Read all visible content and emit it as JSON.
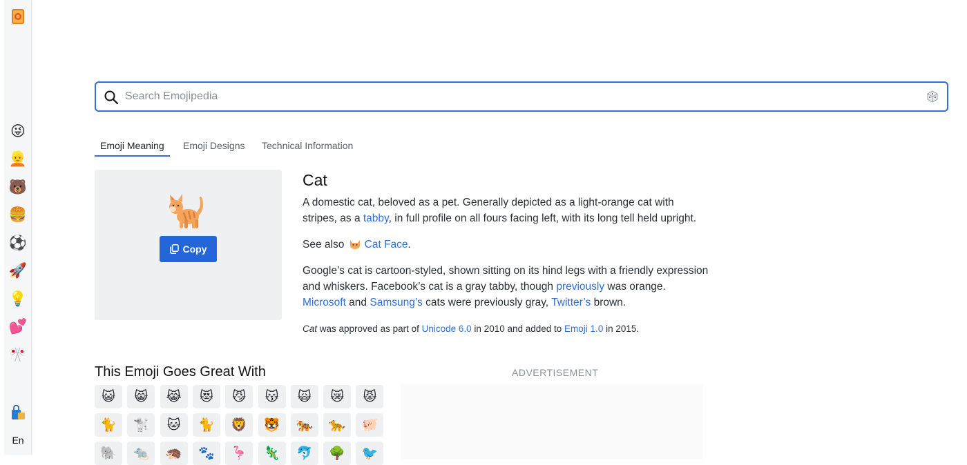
{
  "sidebar": {
    "logo_icon": "emojipedia-logo-icon",
    "items": [
      {
        "icon": "smileys-icon",
        "glyph": "😜"
      },
      {
        "icon": "people-icon",
        "glyph": "👱"
      },
      {
        "icon": "animals-icon",
        "glyph": "🐻"
      },
      {
        "icon": "food-icon",
        "glyph": "🍔"
      },
      {
        "icon": "activities-icon",
        "glyph": "⚽"
      },
      {
        "icon": "travel-icon",
        "glyph": "🚀"
      },
      {
        "icon": "objects-icon",
        "glyph": "💡"
      },
      {
        "icon": "symbols-icon",
        "glyph": "💕"
      },
      {
        "icon": "flags-icon",
        "glyph": "🎌"
      }
    ],
    "bag_icon": "shopping-bag-icon",
    "language": "En"
  },
  "search": {
    "placeholder": "Search Emojipedia",
    "value": ""
  },
  "tabs": [
    {
      "label": "Emoji Meaning",
      "active": true
    },
    {
      "label": "Emoji Designs",
      "active": false
    },
    {
      "label": "Technical Information",
      "active": false
    }
  ],
  "emoji": {
    "glyph": "🐈",
    "copy_label": "Copy",
    "title": "Cat"
  },
  "description": {
    "p1_a": "A domestic cat, beloved as a pet. Generally depicted as a light-orange cat with stripes, as a ",
    "p1_link": "tabby",
    "p1_b": ", in full profile on all fours facing left, with its long tell held upright.",
    "p2_a": "See also ",
    "p2_emoji": "🐱",
    "p2_link": "Cat Face",
    "p2_b": ".",
    "p3_a": "Google’s cat is cartoon-styled, shown sitting on its hind legs with a friendly expression and whiskers. Facebook’s cat is a gray tabby, though ",
    "p3_link1": "previously",
    "p3_b": " was orange. ",
    "p3_link2": "Microsoft",
    "p3_c": " and ",
    "p3_link3": "Samsung’s",
    "p3_d": " cats were previously gray, ",
    "p3_link4": "Twitter’s",
    "p3_e": " brown.",
    "p4_em": "Cat",
    "p4_a": " was approved as part of ",
    "p4_link1": "Unicode 6.0",
    "p4_b": " in 2010 and added to ",
    "p4_link2": "Emoji 1.0",
    "p4_c": " in 2015."
  },
  "goes_great_with": {
    "title": "This Emoji Goes Great With",
    "rows": [
      [
        "😺",
        "😸",
        "😹",
        "😻",
        "😼",
        "😽",
        "🙀",
        "😿",
        "😾"
      ],
      [
        "🐈",
        "🐩",
        "🐱",
        "🐈",
        "🦁",
        "🐯",
        "🐅",
        "🐆",
        "🐖"
      ],
      [
        "🐘",
        "🐀",
        "🦔",
        "🐾",
        "🦩",
        "🦎",
        "🐬",
        "🌳",
        "🐦"
      ]
    ]
  },
  "advertisement": {
    "label": "ADVERTISEMENT"
  },
  "colors": {
    "accent": "#2466d9",
    "link": "#2f6fd6",
    "panel_bg": "#eef0f2"
  }
}
